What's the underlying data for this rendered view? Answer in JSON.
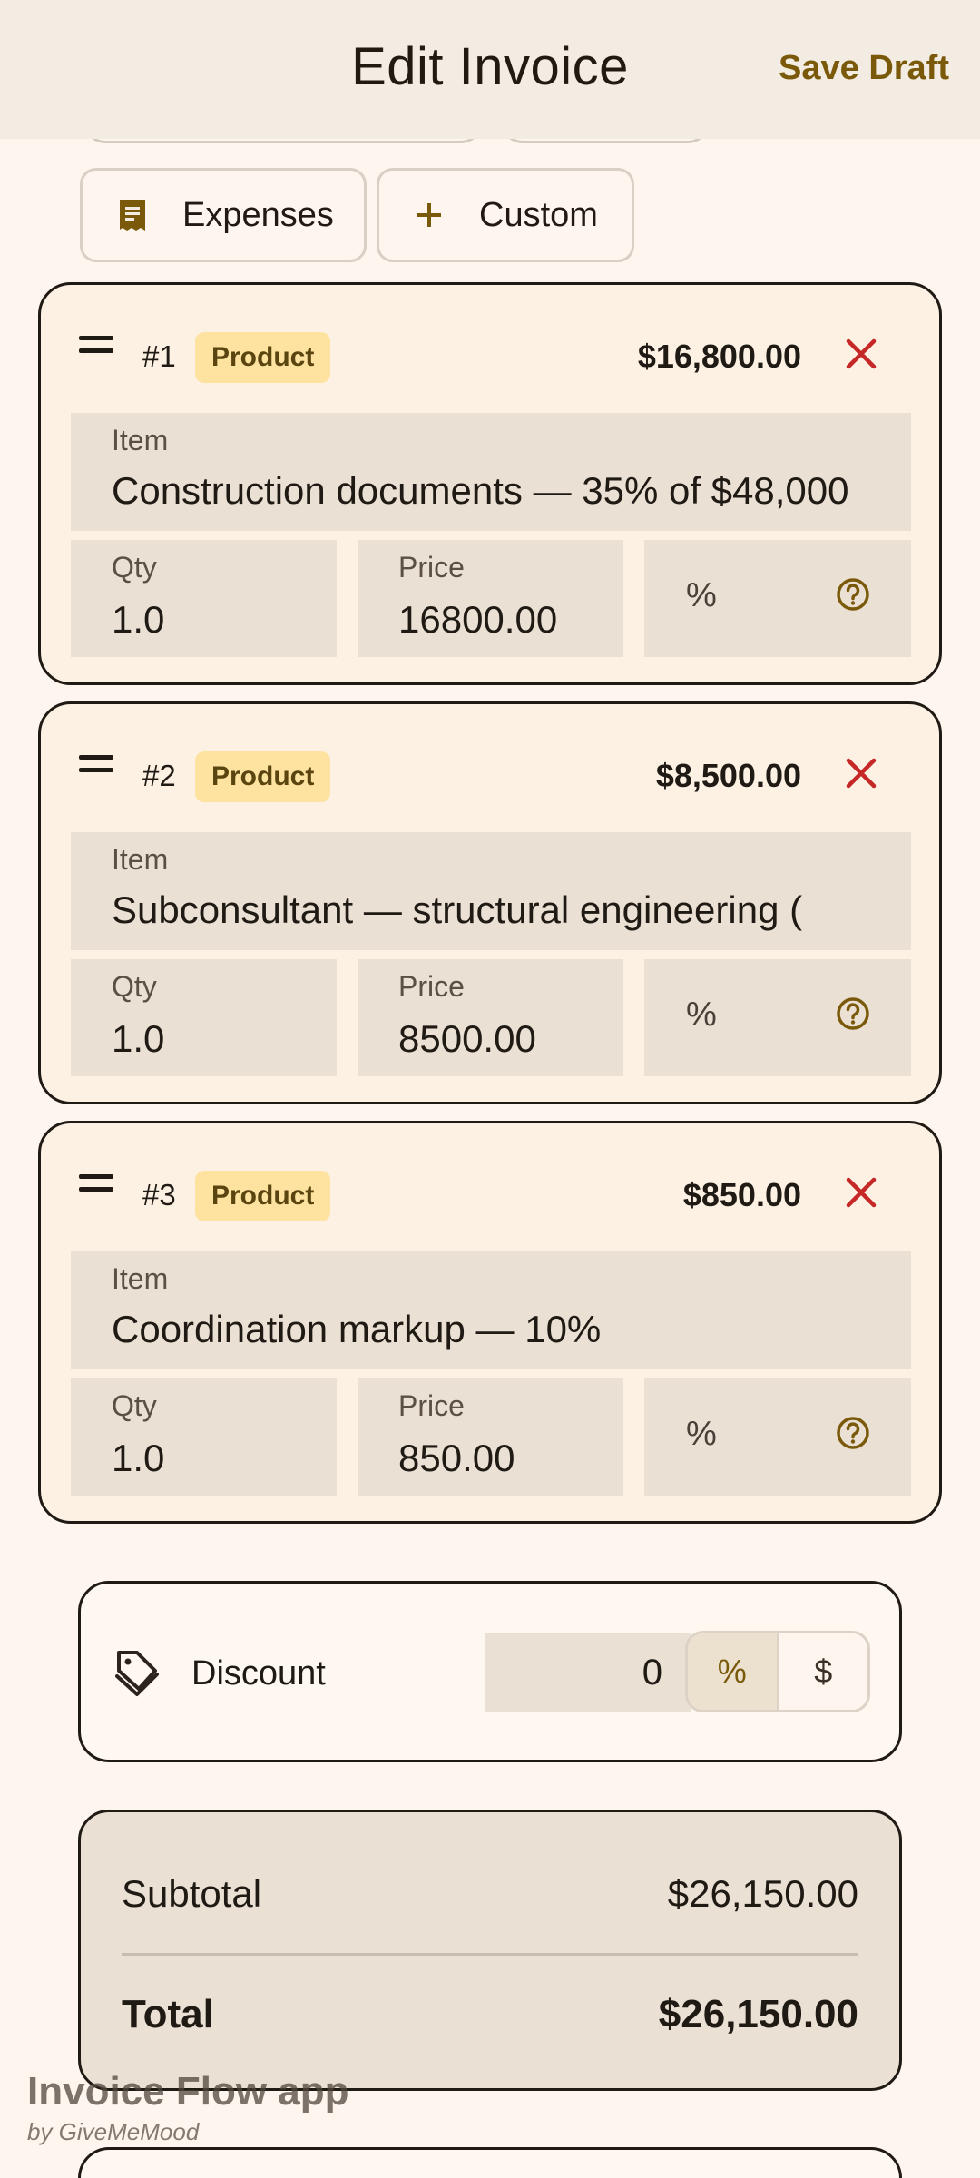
{
  "header": {
    "title": "Edit Invoice",
    "save_label": "Save Draft"
  },
  "chips": {
    "expenses": "Expenses",
    "custom": "Custom"
  },
  "line_items": [
    {
      "number": "#1",
      "type_badge": "Product",
      "amount": "$16,800.00",
      "item_label": "Item",
      "item_value": "Construction documents — 35% of $48,000",
      "qty_label": "Qty",
      "qty_value": "1.0",
      "price_label": "Price",
      "price_value": "16800.00",
      "discount_unit": "%"
    },
    {
      "number": "#2",
      "type_badge": "Product",
      "amount": "$8,500.00",
      "item_label": "Item",
      "item_value": "Subconsultant — structural engineering (",
      "qty_label": "Qty",
      "qty_value": "1.0",
      "price_label": "Price",
      "price_value": "8500.00",
      "discount_unit": "%"
    },
    {
      "number": "#3",
      "type_badge": "Product",
      "amount": "$850.00",
      "item_label": "Item",
      "item_value": "Coordination markup — 10%",
      "qty_label": "Qty",
      "qty_value": "1.0",
      "price_label": "Price",
      "price_value": "850.00",
      "discount_unit": "%"
    }
  ],
  "discount": {
    "label": "Discount",
    "value": "0",
    "mode_percent": "%",
    "mode_dollar": "$",
    "selected": "%"
  },
  "totals": {
    "subtotal_label": "Subtotal",
    "subtotal_value": "$26,150.00",
    "total_label": "Total",
    "total_value": "$26,150.00"
  },
  "watermark": {
    "title": "Invoice Flow app",
    "subtitle": "by GiveMeMood"
  },
  "colors": {
    "accent": "#7a5a0a",
    "danger": "#c62828",
    "badge": "#fde39f",
    "background": "#fdf5ee",
    "field": "#ebe0d4"
  }
}
